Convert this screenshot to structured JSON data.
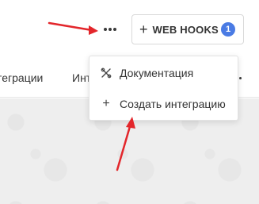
{
  "header": {
    "more_icon": "more-horizontal-icon",
    "webhooks_button": {
      "icon": "plus-icon",
      "plus_glyph": "+",
      "label": "WEB HOOKS",
      "badge": "1",
      "badge_color": "#4a7be4"
    }
  },
  "tabs": {
    "items": [
      "теграции",
      "Инт"
    ],
    "more_icon": "more-horizontal-icon"
  },
  "dropdown": {
    "items": [
      {
        "icon": "tools-icon",
        "label": "Документация"
      },
      {
        "icon": "plus-icon",
        "icon_glyph": "+",
        "label": "Создать интеграцию"
      }
    ]
  },
  "annotations": {
    "arrow_color": "#e3262b"
  }
}
